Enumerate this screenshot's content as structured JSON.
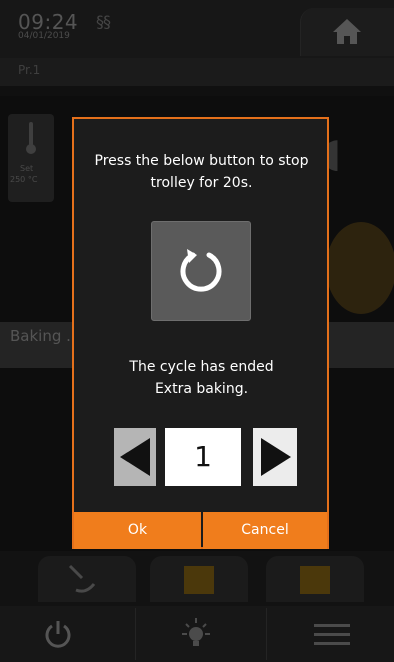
{
  "header": {
    "time": "09:24",
    "date": "04/01/2019",
    "steam_indicator": "§§",
    "home_icon": "home-icon"
  },
  "program": {
    "label": "Pr.1"
  },
  "background": {
    "set_label": "Set",
    "set_temperature": "250 °C",
    "baking_label": "Baking ."
  },
  "dialog": {
    "message_top": "Press the below button to stop trolley for 20s.",
    "restart_icon": "restart-icon",
    "message_line1": "The cycle has ended",
    "message_line2": "Extra baking.",
    "counter_value": "1",
    "ok_label": "Ok",
    "cancel_label": "Cancel",
    "accent_color": "#f07d1c"
  },
  "footer": {
    "icons": [
      "power-icon",
      "bulb-icon",
      "menu-icon"
    ]
  }
}
